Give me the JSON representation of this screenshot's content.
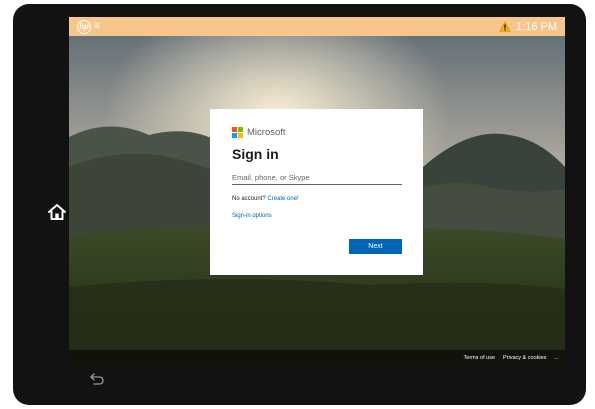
{
  "status_bar": {
    "time": "1:16 PM",
    "brand_text": "hp",
    "menu_glyph": "≡",
    "icons": [
      "hp-logo",
      "menu-icon",
      "warning-icon"
    ],
    "background_color": "#f6c68b"
  },
  "dialog": {
    "brand_name": "Microsoft",
    "title": "Sign in",
    "email_placeholder": "Email, phone, or Skype",
    "email_value": "",
    "no_account_text": "No account?",
    "create_link": "Create one!",
    "signin_options": "Sign-in options",
    "next_label": "Next",
    "logo_colors": [
      "#f25022",
      "#7fba00",
      "#00a4ef",
      "#ffb900"
    ],
    "accent_color": "#0067b8"
  },
  "footer": {
    "terms": "Terms of use",
    "privacy": "Privacy & cookies",
    "more": "..."
  },
  "device": {
    "icons": [
      "home-icon",
      "back-icon"
    ]
  }
}
